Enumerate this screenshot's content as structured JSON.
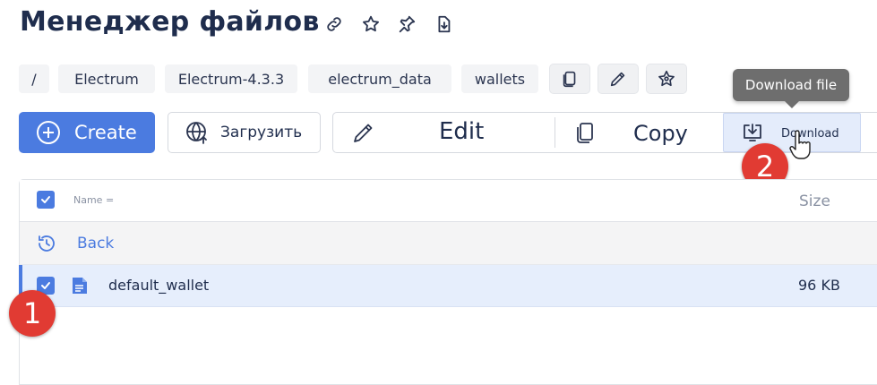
{
  "page": {
    "title": "Менеджер файлов",
    "title_icons": [
      "link-icon",
      "star-icon",
      "pin-icon",
      "download-box-icon"
    ]
  },
  "breadcrumb": {
    "items": [
      "/",
      "Electrum",
      "Electrum-4.3.3",
      "electrum_data",
      "wallets"
    ],
    "action_icons": [
      "copy-icon",
      "pencil-icon",
      "star-badge-icon"
    ]
  },
  "tooltip": {
    "text": "Download file"
  },
  "toolbar": {
    "create_label": "Create",
    "upload_label": "Загрузить",
    "edit_label": "Edit",
    "copy_label": "Copy",
    "download_label": "Download"
  },
  "markers": {
    "one": "1",
    "two": "2"
  },
  "table": {
    "columns": {
      "name": "Name =",
      "size": "Size"
    },
    "back_label": "Back",
    "rows": [
      {
        "name": "default_wallet",
        "size": "96 KB",
        "selected": true
      }
    ]
  },
  "colors": {
    "accent": "#4b7be0",
    "marker": "#e13b33",
    "selected_row": "#e6eefc",
    "tooltip": "#6e6e6e"
  }
}
